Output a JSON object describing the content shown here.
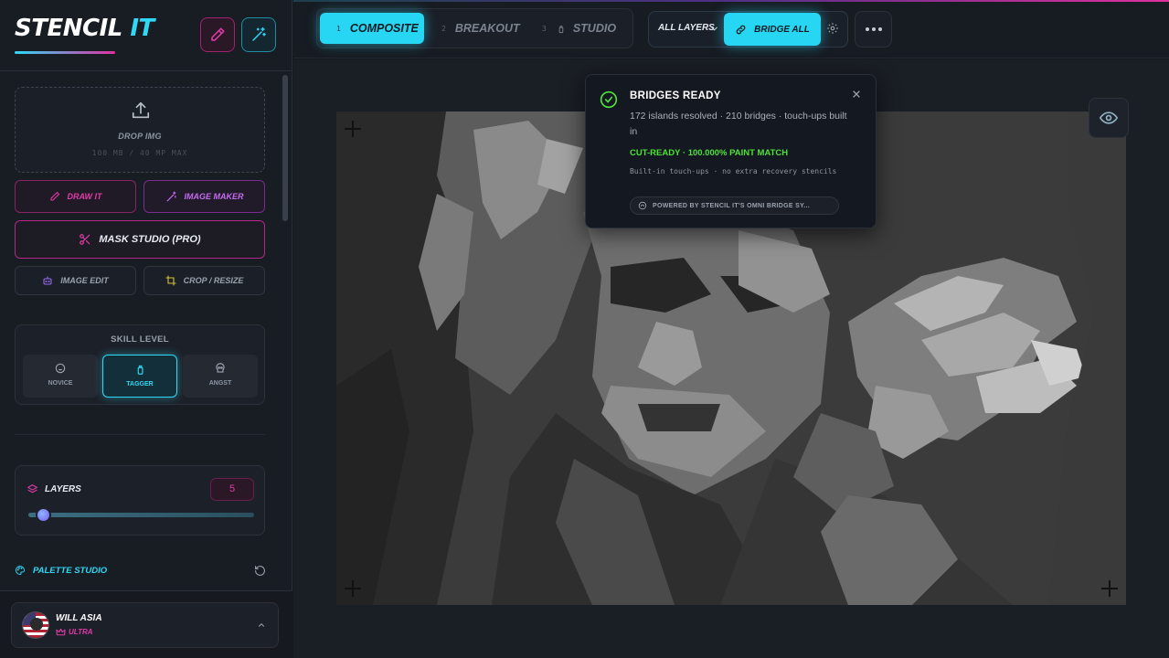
{
  "app": {
    "name_part1": "STENCIL",
    "name_part2": "IT"
  },
  "sidebar": {
    "upload": {
      "label": "DROP IMG",
      "limits": "100 MB / 40 MP MAX"
    },
    "tools": {
      "draw_it": "DRAW IT",
      "image_maker": "IMAGE MAKER",
      "mask_studio": "MASK STUDIO (PRO)",
      "image_edit": "IMAGE EDIT",
      "crop_resize": "CROP / RESIZE"
    },
    "skill": {
      "title": "SKILL LEVEL",
      "options": [
        "NOVICE",
        "TAGGER",
        "ANGST"
      ],
      "selected": "TAGGER"
    },
    "layers": {
      "title": "LAYERS",
      "count": "5"
    },
    "palette": {
      "title": "PALETTE STUDIO"
    },
    "user": {
      "name": "WILL ASIA",
      "tier": "ULTRA"
    }
  },
  "topbar": {
    "tabs": [
      {
        "num": "1",
        "label": "COMPOSITE"
      },
      {
        "num": "2",
        "label": "BREAKOUT"
      },
      {
        "num": "3",
        "label": "STUDIO"
      }
    ],
    "active_tab": "COMPOSITE",
    "layer_select": "ALL LAYERS",
    "bridge_button": "BRIDGE ALL"
  },
  "toast": {
    "title": "BRIDGES READY",
    "body": "172 islands resolved · 210 bridges · touch-ups built in",
    "status": "CUT-READY · 100.000% PAINT MATCH",
    "note": "Built-in touch-ups · no extra recovery stencils",
    "badge": "POWERED BY STENCIL IT'S OMNI BRIDGE SY..."
  },
  "colors": {
    "accent_cyan": "#26d6f3",
    "accent_pink": "#e23aa8",
    "success_green": "#4ee23a",
    "background": "#161a20"
  }
}
